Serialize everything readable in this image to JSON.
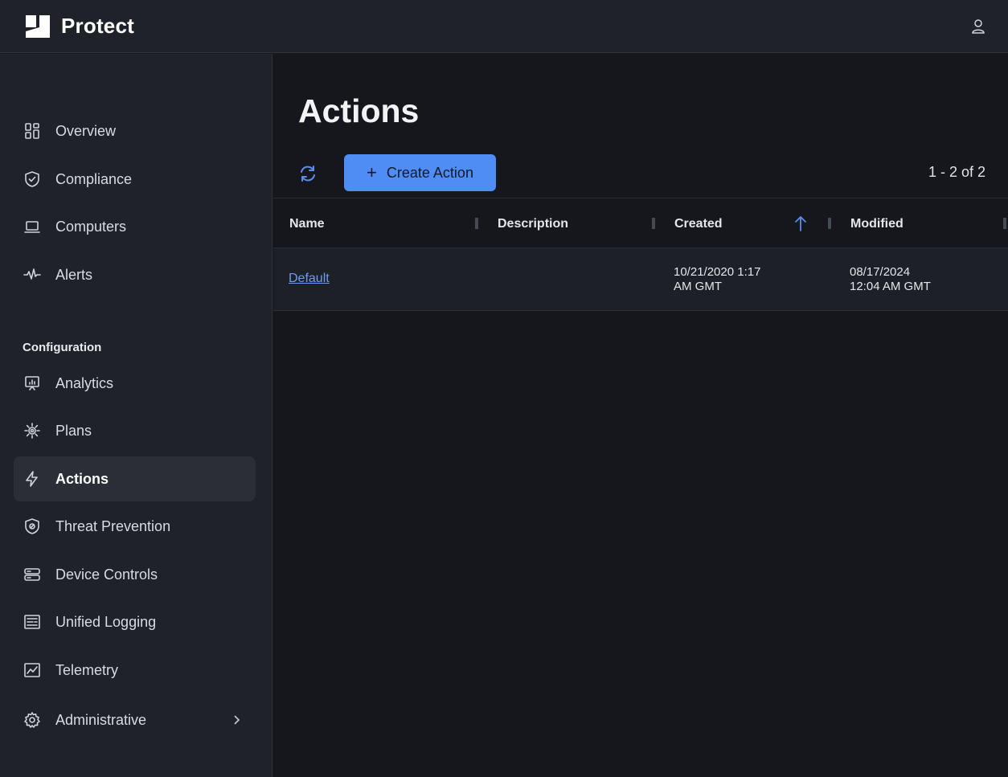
{
  "header": {
    "app_name": "Protect"
  },
  "sidebar": {
    "items": [
      {
        "label": "Overview",
        "icon": "grid-icon"
      },
      {
        "label": "Compliance",
        "icon": "shield-check-icon"
      },
      {
        "label": "Computers",
        "icon": "laptop-icon"
      },
      {
        "label": "Alerts",
        "icon": "pulse-icon"
      }
    ],
    "section_label": "Configuration",
    "config_items": [
      {
        "label": "Analytics",
        "icon": "presentation-chart-icon"
      },
      {
        "label": "Plans",
        "icon": "gear-sun-icon"
      },
      {
        "label": "Actions",
        "icon": "lightning-icon",
        "active": true
      },
      {
        "label": "Threat Prevention",
        "icon": "shield-lock-icon"
      },
      {
        "label": "Device Controls",
        "icon": "storage-icon"
      },
      {
        "label": "Unified Logging",
        "icon": "log-list-icon"
      },
      {
        "label": "Telemetry",
        "icon": "chart-window-icon"
      },
      {
        "label": "Administrative",
        "icon": "gear-icon"
      }
    ]
  },
  "main": {
    "title": "Actions",
    "create_label": "Create Action",
    "pager": "1 - 2 of 2",
    "columns": [
      "Name",
      "Description",
      "Created",
      "Modified"
    ],
    "rows": [
      {
        "name": "Default",
        "description": "",
        "created_line1": "10/21/2020 1:17",
        "created_line2": "AM GMT",
        "modified_line1": "08/17/2024",
        "modified_line2": "12:04 AM GMT"
      }
    ]
  },
  "colors": {
    "accent": "#4f8df5",
    "background": "#15171d",
    "sidebar": "#1f2229"
  }
}
